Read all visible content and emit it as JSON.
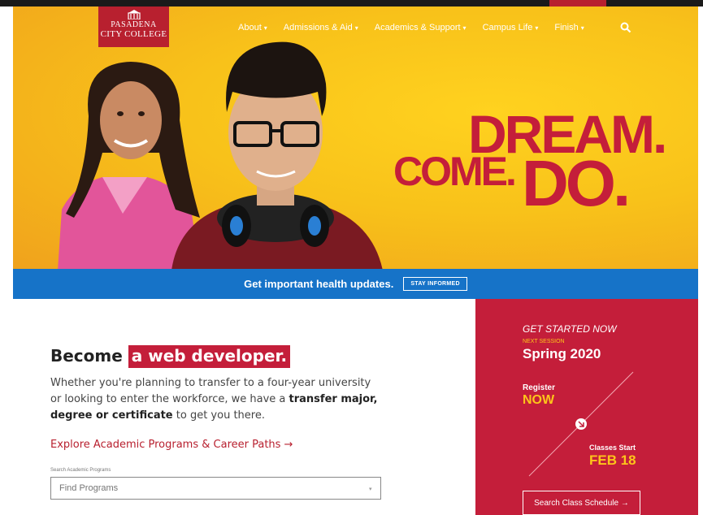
{
  "logo": {
    "line1": "PASADENA",
    "line2": "CITY COLLEGE"
  },
  "nav": {
    "items": [
      {
        "label": "About"
      },
      {
        "label": "Admissions & Aid"
      },
      {
        "label": "Academics & Support"
      },
      {
        "label": "Campus Life"
      },
      {
        "label": "Finish"
      }
    ],
    "search_icon": "search-icon"
  },
  "hero": {
    "headline_dream": "DREAM.",
    "headline_come": "COME.",
    "headline_do": "DO."
  },
  "alert": {
    "message": "Get important health updates.",
    "button_label": "STAY INFORMED"
  },
  "main": {
    "become_prefix": "Become",
    "become_highlight": "a web developer.",
    "description_part1": "Whether you're planning to transfer to a four-year university or looking to enter the workforce, we have a ",
    "description_bold": "transfer major, degree or certificate",
    "description_part2": " to get you there.",
    "explore_link": "Explore Academic Programs & Career Paths →",
    "search_label": "Search Academic Programs",
    "search_placeholder": "Find Programs"
  },
  "panel": {
    "title": "GET STARTED NOW",
    "next_session_label": "NEXT SESSION",
    "session": "Spring 2020",
    "register_label": "Register",
    "register_value": "NOW",
    "classes_label": "Classes Start",
    "classes_value": "FEB 18",
    "button_label": "Search Class Schedule →"
  },
  "colors": {
    "brand_red": "#c41e3a",
    "accent_yellow": "#fdc51a",
    "alert_blue": "#1673c8"
  }
}
